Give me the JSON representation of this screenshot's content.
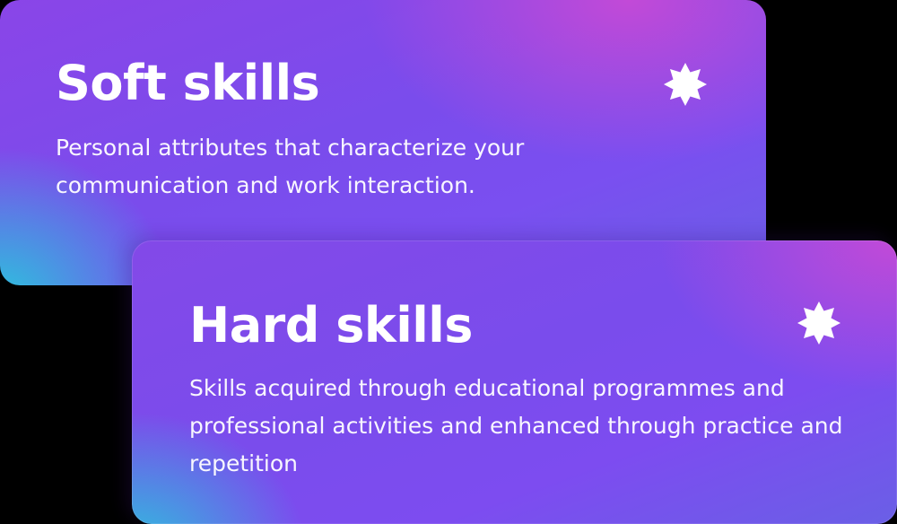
{
  "cards": {
    "soft": {
      "title": "Soft skills",
      "description": "Personal attributes that characterize your communication and work interaction.",
      "icon": "star-burst-icon"
    },
    "hard": {
      "title": "Hard skills",
      "description": "Skills acquired through educational programmes and professional activities and enhanced through practice and repetition",
      "icon": "star-burst-icon"
    }
  },
  "colors": {
    "background": "#000000",
    "card_purple": "#7a4cec",
    "accent_magenta": "#c64ad6",
    "accent_cyan": "#28c8dc",
    "text": "#ffffff"
  }
}
